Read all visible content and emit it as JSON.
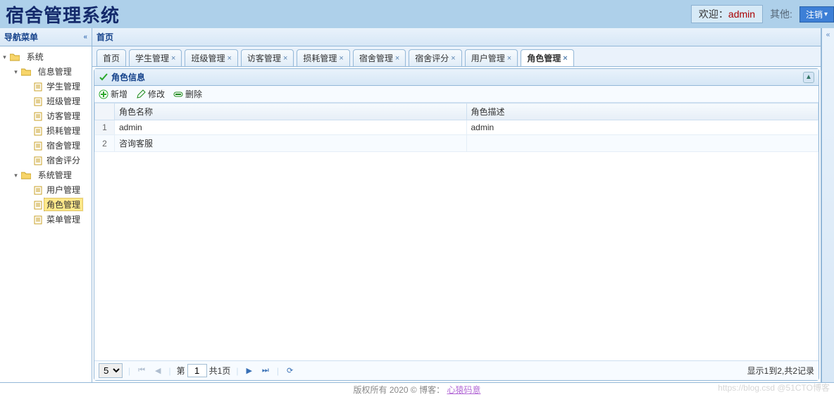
{
  "header": {
    "logo": "宿舍管理系统",
    "welcome_label": "欢迎：",
    "user": "admin",
    "other_label": "其他:",
    "logout": "注销"
  },
  "sidebar": {
    "title": "导航菜单",
    "root": {
      "label": "系统",
      "children": [
        {
          "label": "信息管理",
          "children": [
            {
              "label": "学生管理"
            },
            {
              "label": "班级管理"
            },
            {
              "label": "访客管理"
            },
            {
              "label": "损耗管理"
            },
            {
              "label": "宿舍管理"
            },
            {
              "label": "宿舍评分"
            }
          ]
        },
        {
          "label": "系统管理",
          "children": [
            {
              "label": "用户管理"
            },
            {
              "label": "角色管理",
              "selected": true
            },
            {
              "label": "菜单管理"
            }
          ]
        }
      ]
    }
  },
  "main": {
    "title": "首页",
    "tabs": [
      {
        "label": "首页",
        "closable": false
      },
      {
        "label": "学生管理",
        "closable": true
      },
      {
        "label": "班级管理",
        "closable": true
      },
      {
        "label": "访客管理",
        "closable": true
      },
      {
        "label": "损耗管理",
        "closable": true
      },
      {
        "label": "宿舍管理",
        "closable": true
      },
      {
        "label": "宿舍评分",
        "closable": true
      },
      {
        "label": "用户管理",
        "closable": true
      },
      {
        "label": "角色管理",
        "closable": true,
        "active": true
      }
    ],
    "panel_title": "角色信息",
    "toolbar": {
      "add": "新增",
      "edit": "修改",
      "delete": "删除"
    },
    "columns": {
      "name": "角色名称",
      "desc": "角色描述"
    },
    "rows": [
      {
        "name": "admin",
        "desc": "admin"
      },
      {
        "name": "咨询客服",
        "desc": ""
      }
    ],
    "pager": {
      "page_size": "5",
      "page_label_prefix": "第",
      "page_value": "1",
      "page_total_label": "共1页",
      "info": "显示1到2,共2记录"
    }
  },
  "footer": {
    "text": "版权所有 2020 © 博客：",
    "author": "心猿码意",
    "watermark_left": "https://blog.csd",
    "watermark_right": "@51CTO博客"
  }
}
